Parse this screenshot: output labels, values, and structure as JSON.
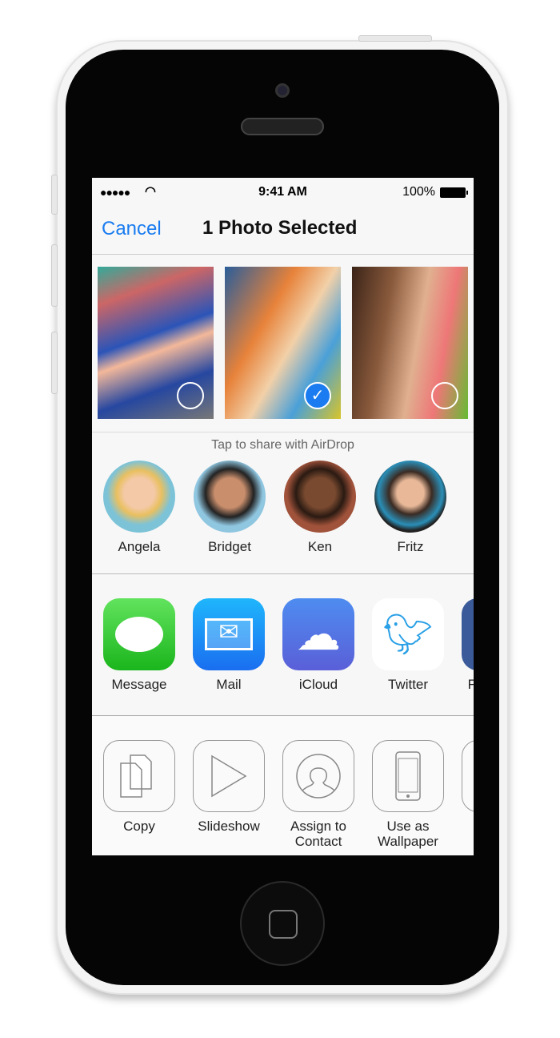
{
  "status_bar": {
    "signal": "●●●●●",
    "time": "9:41 AM",
    "battery": "100%"
  },
  "nav": {
    "cancel": "Cancel",
    "title": "1 Photo Selected"
  },
  "photos": [
    {
      "selected": false
    },
    {
      "selected": true
    },
    {
      "selected": false
    }
  ],
  "airdrop": {
    "label": "Tap to share with AirDrop",
    "people": [
      {
        "name": "Angela"
      },
      {
        "name": "Bridget"
      },
      {
        "name": "Ken"
      },
      {
        "name": "Fritz"
      }
    ]
  },
  "apps": [
    {
      "label": "Message",
      "icon": "message-icon"
    },
    {
      "label": "Mail",
      "icon": "mail-icon"
    },
    {
      "label": "iCloud",
      "icon": "icloud-icon"
    },
    {
      "label": "Twitter",
      "icon": "twitter-icon"
    },
    {
      "label": "Facebook",
      "icon": "facebook-icon"
    }
  ],
  "actions": [
    {
      "label": "Copy",
      "icon": "copy-icon"
    },
    {
      "label": "Slideshow",
      "icon": "play-icon"
    },
    {
      "label": "Assign to\nContact",
      "icon": "contact-icon"
    },
    {
      "label": "Use as\nWallpaper",
      "icon": "phone-icon"
    }
  ],
  "colors": {
    "accent": "#1a7cf0"
  }
}
